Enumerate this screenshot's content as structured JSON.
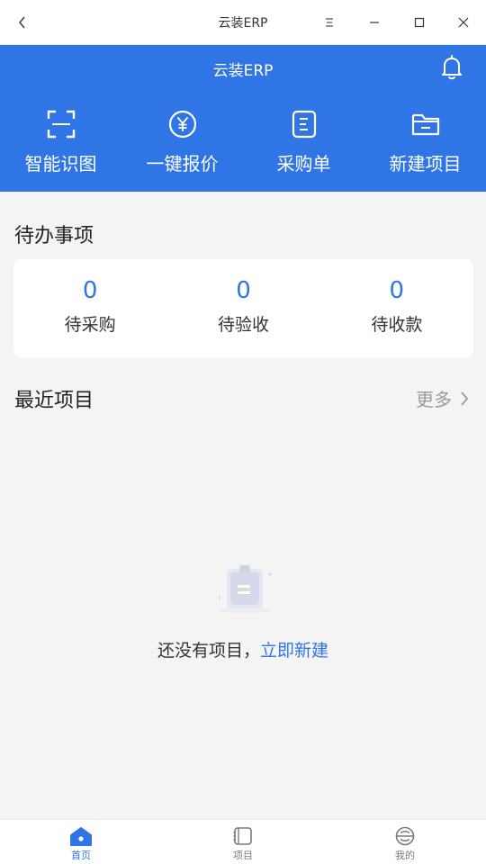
{
  "window": {
    "title": "云装ERP",
    "controls": [
      "menu-icon",
      "minimize-icon",
      "maximize-icon",
      "close-icon"
    ]
  },
  "header": {
    "title": "云装ERP",
    "bell_icon": "bell-icon",
    "background_color": "#2f75e5",
    "quick_actions": [
      {
        "label": "智能识图",
        "icon": "scan-icon"
      },
      {
        "label": "一键报价",
        "icon": "yen-circle-icon"
      },
      {
        "label": "采购单",
        "icon": "document-icon"
      },
      {
        "label": "新建项目",
        "icon": "folder-open-icon"
      }
    ]
  },
  "todo": {
    "title": "待办事项",
    "items": [
      {
        "count": "0",
        "label": "待采购"
      },
      {
        "count": "0",
        "label": "待验收"
      },
      {
        "count": "0",
        "label": "待收款"
      }
    ]
  },
  "recent": {
    "title": "最近项目",
    "more_label": "更多",
    "empty_text": "还没有项目，",
    "create_link": "立即新建"
  },
  "tabbar": {
    "tabs": [
      {
        "label": "首页",
        "icon": "home-icon",
        "active": true
      },
      {
        "label": "项目",
        "icon": "notebook-icon",
        "active": false
      },
      {
        "label": "我的",
        "icon": "profile-icon",
        "active": false
      }
    ]
  },
  "colors": {
    "accent": "#2f75e5",
    "page_background": "#f4f4f4",
    "muted_text": "#9a9a9a"
  }
}
